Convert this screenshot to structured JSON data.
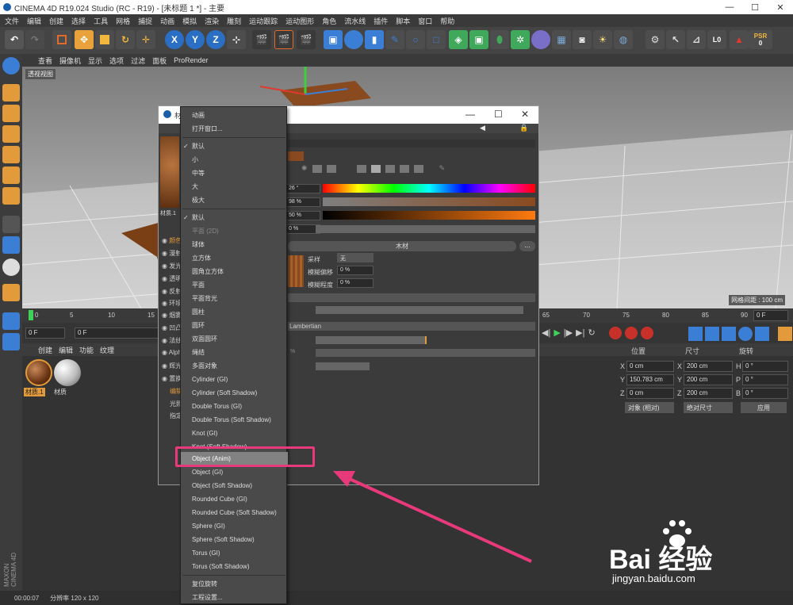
{
  "window_title": "CINEMA 4D R19.024 Studio (RC - R19) - [未标题 1 *] - 主要",
  "window_controls": {
    "minimize": "—",
    "maximize": "☐",
    "close": "✕"
  },
  "menubar": [
    "文件",
    "编辑",
    "创建",
    "选择",
    "工具",
    "网格",
    "捕捉",
    "动画",
    "模拟",
    "渲染",
    "雕刻",
    "运动跟踪",
    "运动图形",
    "角色",
    "流水线",
    "插件",
    "脚本",
    "窗口",
    "帮助"
  ],
  "toolbar": {
    "x_label": "X",
    "y_label": "Y",
    "z_label": "Z",
    "psr_label": "PSR",
    "psr_value": "0",
    "l_label": "L0"
  },
  "viewport_menu": [
    "查看",
    "摄像机",
    "显示",
    "选项",
    "过滤",
    "面板",
    "ProRender"
  ],
  "viewport": {
    "label": "透视视图",
    "grid_spacing": "网格间距 : 100 cm"
  },
  "timeline": {
    "ticks": [
      "0",
      "5",
      "10",
      "15",
      "65",
      "70",
      "75",
      "80",
      "85",
      "90"
    ],
    "frame_end": "0 F"
  },
  "transport": {
    "current_frame": "0 F",
    "start_frame": "0 F"
  },
  "material_manager": {
    "menu": [
      "创建",
      "编辑",
      "功能",
      "纹理"
    ],
    "materials": [
      {
        "name": "材质.1"
      },
      {
        "name": "材质"
      }
    ]
  },
  "attributes": {
    "headers": [
      "位置",
      "尺寸",
      "旋转"
    ],
    "rows": [
      {
        "a": "X",
        "pos": "0 cm",
        "b": "X",
        "size": "200 cm",
        "c": "H",
        "rot": "0 °"
      },
      {
        "a": "Y",
        "pos": "150.783 cm",
        "b": "Y",
        "size": "200 cm",
        "c": "P",
        "rot": "0 °"
      },
      {
        "a": "Z",
        "pos": "0 cm",
        "b": "Z",
        "size": "200 cm",
        "c": "B",
        "rot": "0 °"
      }
    ],
    "mode": "对象 (相对)",
    "size_mode": "绝对尺寸",
    "apply": "应用"
  },
  "dialog": {
    "title": "材",
    "channels": [
      "颜色",
      "漫射",
      "发光",
      "透明",
      "反射",
      "环境",
      "烟雾",
      "凹凸",
      "法线",
      "Alpha",
      "辉光",
      "置换",
      "编辑",
      "光照",
      "指定"
    ],
    "material_name": "材质.1",
    "values": {
      "hue": "26 °",
      "sat": "98 %",
      "val": "50 %",
      "brightness": "0 %",
      "texture": "木材",
      "sampling_label": "采样",
      "sampling": "无",
      "blur_offset_label": "模糊偏移",
      "blur_offset": "0 %",
      "blur_scale_label": "模糊程度",
      "blur_scale": "0 %",
      "shader": "Lambertian",
      "mix": "%"
    },
    "texture_button": "..."
  },
  "dropdown": {
    "items": [
      {
        "label": "动画",
        "state": "normal"
      },
      {
        "label": "打开窗口...",
        "state": "normal"
      },
      {
        "label": "默认",
        "state": "checked"
      },
      {
        "label": "小",
        "state": "normal"
      },
      {
        "label": "中等",
        "state": "normal"
      },
      {
        "label": "大",
        "state": "normal"
      },
      {
        "label": "极大",
        "state": "normal"
      },
      {
        "label": "默认",
        "state": "checked"
      },
      {
        "label": "平面 (2D)",
        "state": "dim"
      },
      {
        "label": "球体",
        "state": "normal"
      },
      {
        "label": "立方体",
        "state": "normal"
      },
      {
        "label": "圆角立方体",
        "state": "normal"
      },
      {
        "label": "平面",
        "state": "normal"
      },
      {
        "label": "平面背光",
        "state": "normal"
      },
      {
        "label": "圆柱",
        "state": "normal"
      },
      {
        "label": "圆环",
        "state": "normal"
      },
      {
        "label": "双面圆环",
        "state": "normal"
      },
      {
        "label": "绳结",
        "state": "normal"
      },
      {
        "label": "多面对象",
        "state": "normal"
      },
      {
        "label": "Cylinder (GI)",
        "state": "normal"
      },
      {
        "label": "Cylinder (Soft Shadow)",
        "state": "normal"
      },
      {
        "label": "Double Torus (GI)",
        "state": "normal"
      },
      {
        "label": "Double Torus (Soft Shadow)",
        "state": "normal"
      },
      {
        "label": "Knot (GI)",
        "state": "normal"
      },
      {
        "label": "Knot (Soft Shadow)",
        "state": "normal"
      },
      {
        "label": "Object (Anim)",
        "state": "selected"
      },
      {
        "label": "Object (GI)",
        "state": "normal"
      },
      {
        "label": "Object (Soft Shadow)",
        "state": "normal"
      },
      {
        "label": "Rounded Cube (GI)",
        "state": "normal"
      },
      {
        "label": "Rounded Cube (Soft Shadow)",
        "state": "normal"
      },
      {
        "label": "Sphere (GI)",
        "state": "normal"
      },
      {
        "label": "Sphere (Soft Shadow)",
        "state": "normal"
      },
      {
        "label": "Torus (GI)",
        "state": "normal"
      },
      {
        "label": "Torus (Soft Shadow)",
        "state": "normal"
      },
      {
        "label": "复位旋转",
        "state": "normal"
      },
      {
        "label": "工程设置...",
        "state": "normal"
      }
    ]
  },
  "statusbar": {
    "time": "00:00:07",
    "resolution": "分辨率 120 x 120"
  },
  "branding": {
    "maxon": "MAXON CINEMA 4D",
    "watermark_brand": "Bai 经验",
    "watermark_url": "jingyan.baidu.com"
  },
  "colors": {
    "highlight": "#e8397b",
    "accent": "#3a7fd5",
    "wood": "#8a4a1f"
  }
}
